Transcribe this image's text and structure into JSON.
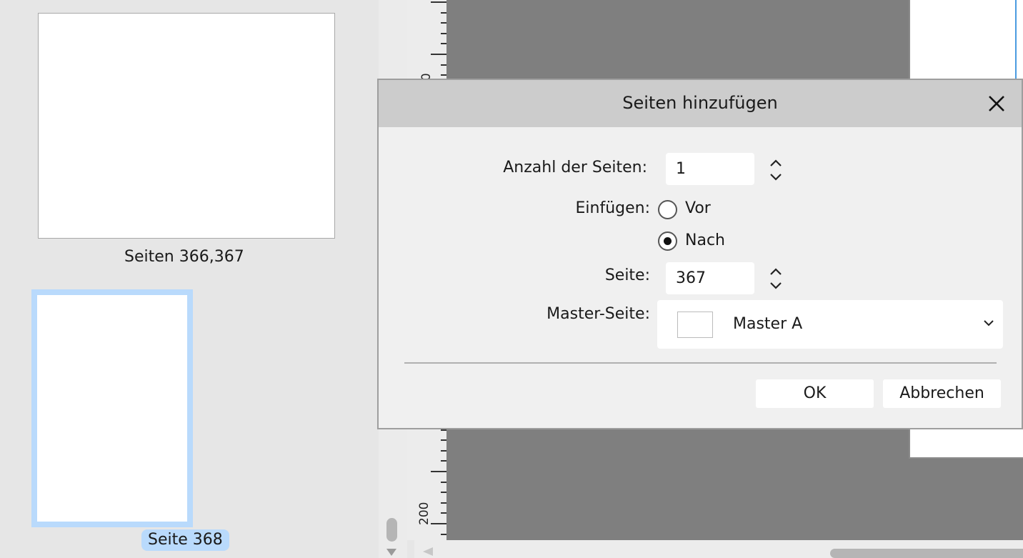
{
  "pages_panel": {
    "spread_label": "Seiten 366,367",
    "page_label": "Seite 368"
  },
  "ruler": {
    "label_top": "00",
    "label_bottom": "200"
  },
  "dialog": {
    "title": "Seiten hinzufügen",
    "close_icon": "close-icon",
    "count_label": "Anzahl der Seiten:",
    "count_value": "1",
    "insert_label": "Einfügen:",
    "insert_options": [
      "Vor",
      "Nach"
    ],
    "insert_selected": "Nach",
    "page_label": "Seite:",
    "page_value": "367",
    "master_label": "Master-Seite:",
    "master_value": "Master A",
    "ok_label": "OK",
    "cancel_label": "Abbrechen"
  },
  "colors": {
    "selection": "#b9dafc",
    "canvas": "#7f7f7f",
    "guide": "#4a9be0"
  }
}
